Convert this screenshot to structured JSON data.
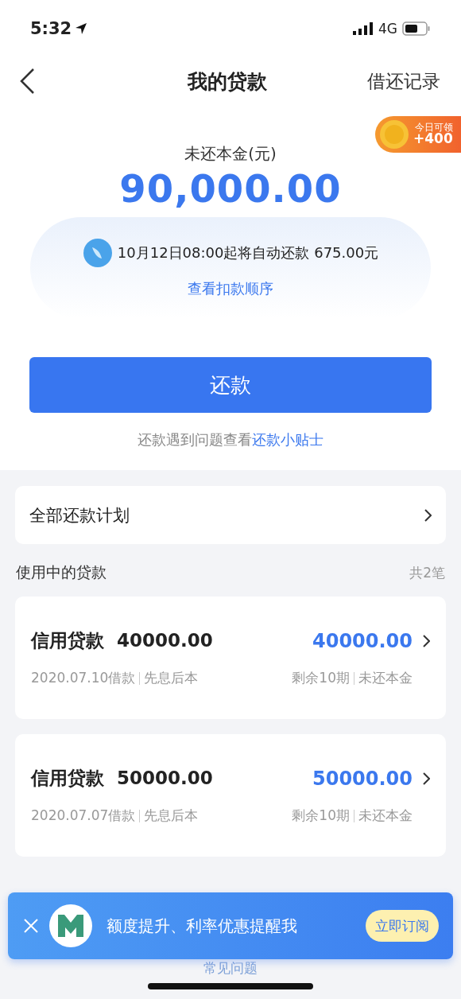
{
  "status_bar": {
    "time": "5:32",
    "network": "4G"
  },
  "nav": {
    "title": "我的贷款",
    "action": "借还记录"
  },
  "reward_badge": {
    "label": "今日可领",
    "amount": "+400"
  },
  "summary": {
    "label": "未还本金(元)",
    "amount": "90,000.00",
    "notice": "10月12日08:00起将自动还款 675.00元",
    "link": "查看扣款顺序"
  },
  "repay_button": "还款",
  "tip": {
    "text": "还款遇到问题查看",
    "link": "还款小贴士"
  },
  "plan_row": "全部还款计划",
  "loans_header": {
    "title": "使用中的贷款",
    "count": "共2笔"
  },
  "loans": [
    {
      "name": "信用贷款",
      "principal": "40000.00",
      "outstanding": "40000.00",
      "date": "2020.07.10借款",
      "method": "先息后本",
      "remaining": "剩余10期",
      "outstanding_label": "未还本金"
    },
    {
      "name": "信用贷款",
      "principal": "50000.00",
      "outstanding": "50000.00",
      "date": "2020.07.07借款",
      "method": "先息后本",
      "remaining": "剩余10期",
      "outstanding_label": "未还本金"
    }
  ],
  "promo_banner": {
    "text": "额度提升、利率优惠提醒我",
    "button": "立即订阅"
  },
  "faq_link": "常见问题"
}
